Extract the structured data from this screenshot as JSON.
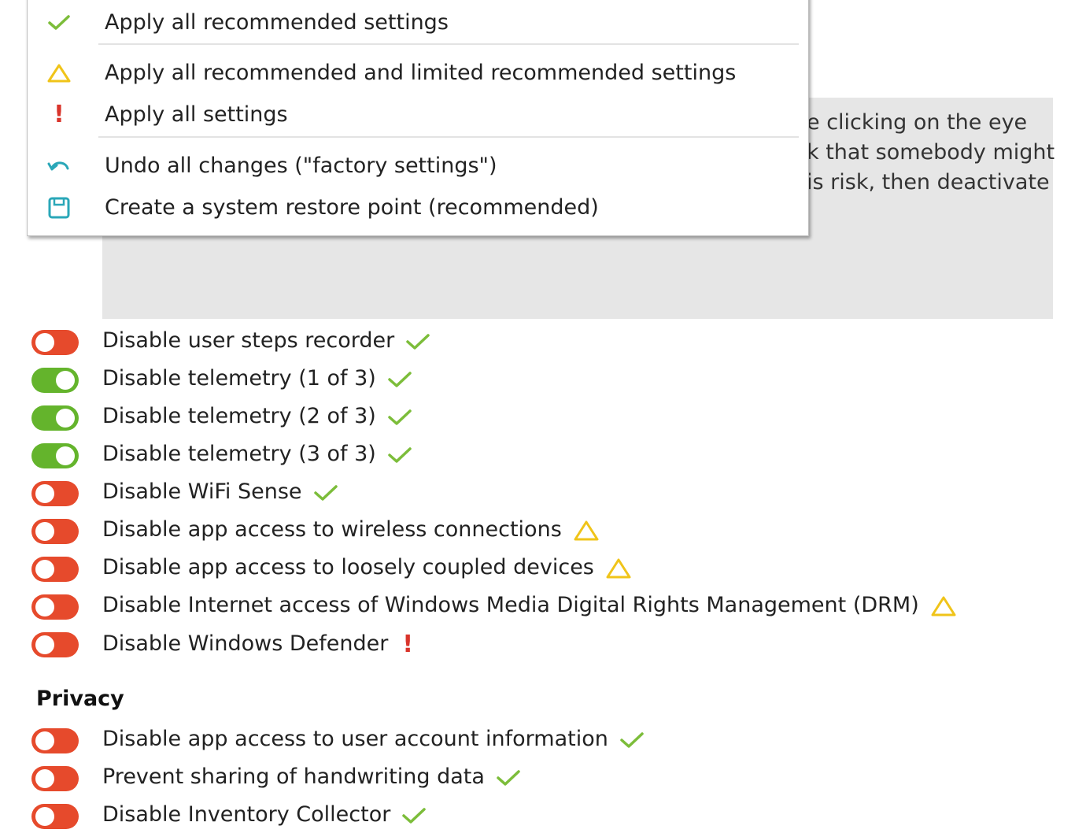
{
  "context_menu": {
    "items": [
      {
        "icon": "check-icon",
        "label": "Apply all recommended settings"
      },
      {
        "icon": "warning-triangle-icon",
        "label": "Apply all recommended and limited recommended settings"
      },
      {
        "icon": "exclamation-icon",
        "label": "Apply all settings"
      },
      {
        "icon": "undo-icon",
        "label": "Undo all changes (\"factory settings\")"
      },
      {
        "icon": "save-icon",
        "label": "Create a system restore point (recommended)"
      }
    ]
  },
  "info_panel": {
    "lines": [
      "e clicking on the eye",
      "k that somebody might",
      "is risk, then deactivate"
    ]
  },
  "settings": [
    {
      "label": "Disable user steps recorder",
      "enabled": false,
      "status": "recommended"
    },
    {
      "label": "Disable telemetry (1 of 3)",
      "enabled": true,
      "status": "recommended"
    },
    {
      "label": "Disable telemetry (2 of 3)",
      "enabled": true,
      "status": "recommended"
    },
    {
      "label": "Disable telemetry (3 of 3)",
      "enabled": true,
      "status": "recommended"
    },
    {
      "label": "Disable WiFi Sense",
      "enabled": false,
      "status": "recommended"
    },
    {
      "label": "Disable app access to wireless connections",
      "enabled": false,
      "status": "limited"
    },
    {
      "label": "Disable app access to loosely coupled devices",
      "enabled": false,
      "status": "limited"
    },
    {
      "label": "Disable Internet access of Windows Media Digital Rights Management (DRM)",
      "enabled": false,
      "status": "limited"
    },
    {
      "label": "Disable Windows Defender",
      "enabled": false,
      "status": "not-recommended"
    }
  ],
  "privacy_section": {
    "heading": "Privacy",
    "settings": [
      {
        "label": "Disable app access to user account information",
        "enabled": false,
        "status": "recommended"
      },
      {
        "label": "Prevent sharing of handwriting data",
        "enabled": false,
        "status": "recommended"
      },
      {
        "label": "Disable Inventory Collector",
        "enabled": false,
        "status": "recommended"
      }
    ]
  },
  "colors": {
    "toggle_off": "#e64a2c",
    "toggle_on": "#64b42c",
    "check": "#7cbd3a",
    "warning": "#f0c419",
    "danger": "#d9342b",
    "accent_teal": "#2aa7b8"
  }
}
